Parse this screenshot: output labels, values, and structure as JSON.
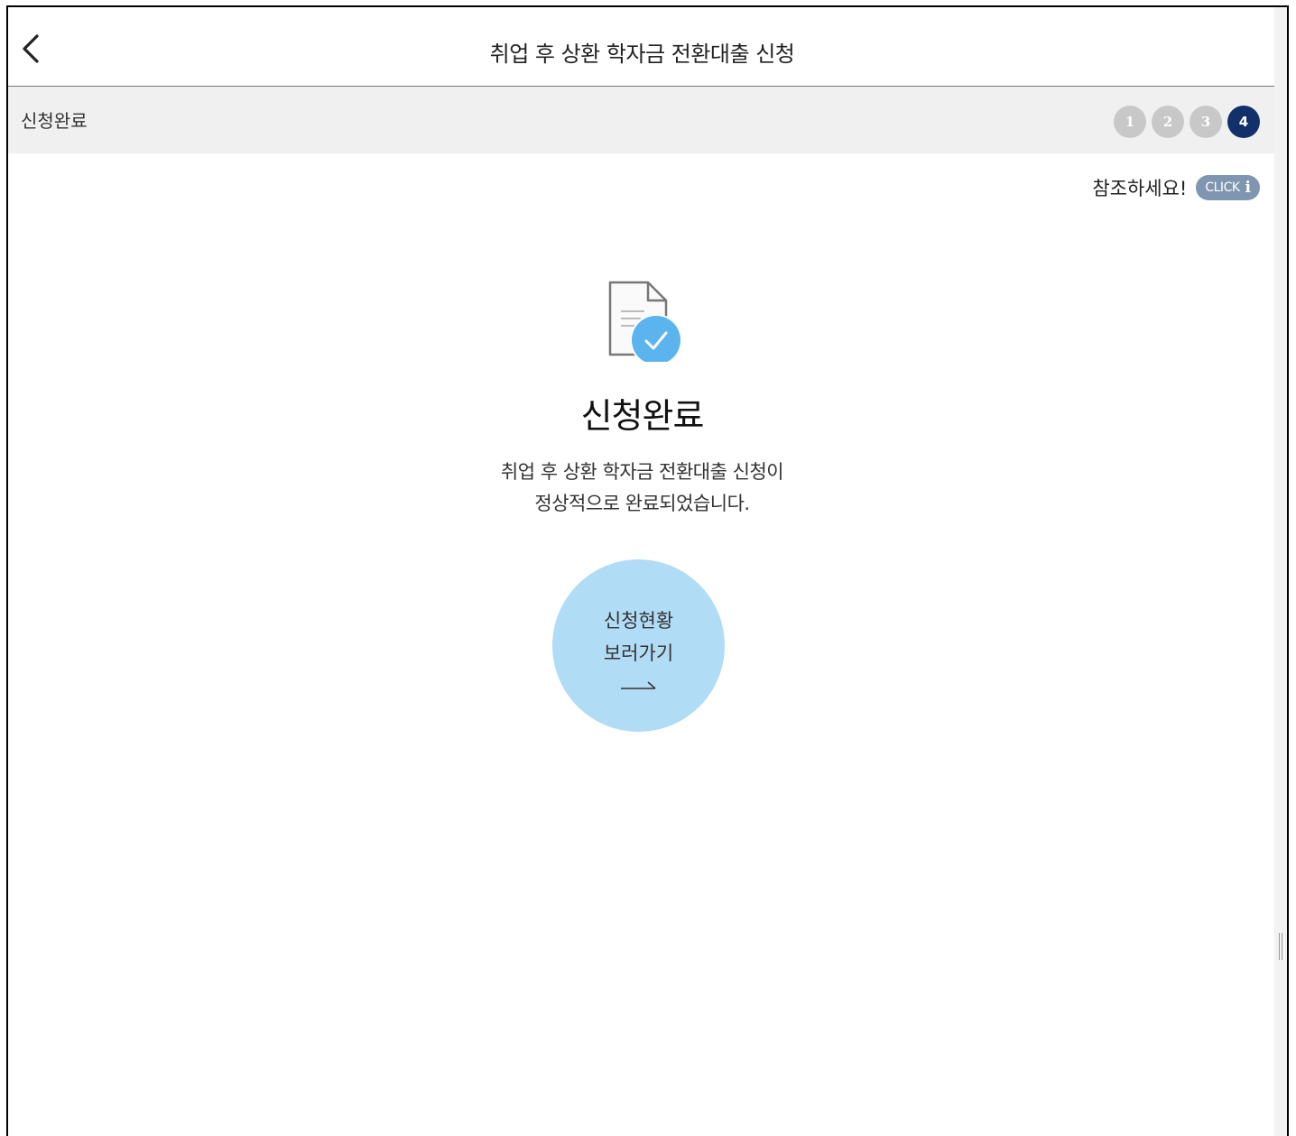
{
  "header": {
    "title": "취업 후 상환 학자금 전환대출 신청",
    "back_icon": "chevron-left-icon"
  },
  "stepbar": {
    "label": "신청완료",
    "steps": [
      "1",
      "2",
      "3",
      "4"
    ],
    "current_step": 4
  },
  "reference": {
    "text": "참조하세요!",
    "button_label": "CLICK",
    "button_icon": "i"
  },
  "result": {
    "icon": "document-check-icon",
    "title": "신청완료",
    "message_line1": "취업 후 상환 학자금 전환대출 신청이",
    "message_line2": "정상적으로 완료되었습니다."
  },
  "status_button": {
    "line1": "신청현황",
    "line2": "보러가기",
    "icon": "arrow-right-icon"
  },
  "colors": {
    "step_inactive": "#c8c8c8",
    "step_active": "#12316b",
    "click_pill": "#7f95b0",
    "check_circle": "#5cb4ee",
    "status_button": "#b1dcf5",
    "stepbar_bg": "#f0f0f0"
  }
}
